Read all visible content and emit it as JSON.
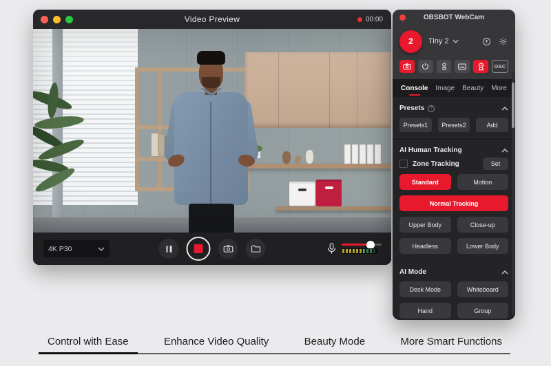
{
  "video_window": {
    "title": "Video Preview",
    "rec_time": "00:00",
    "resolution": "4K P30"
  },
  "panel": {
    "title": "OBSBOT WebCam",
    "device_badge": "2",
    "device_name": "Tiny 2",
    "toolbar": {
      "osc_label": "OSC"
    },
    "tabs": [
      "Console",
      "Image",
      "Beauty",
      "More"
    ],
    "active_tab": "Console",
    "presets": {
      "title": "Presets",
      "help_glyph": "?",
      "buttons": [
        "Presets1",
        "Presets2",
        "Add"
      ]
    },
    "tracking": {
      "title": "AI Human Tracking",
      "zone_label": "Zone Tracking",
      "zone_checked": false,
      "set_label": "Set",
      "standard": "Standard",
      "motion": "Motion",
      "normal": "Normal Tracking",
      "upper": "Upper Body",
      "closeup": "Close-up",
      "headless": "Headless",
      "lower": "Lower Body",
      "active_mode": "Standard",
      "active_tracking": "Normal Tracking"
    },
    "ai_mode": {
      "title": "AI Mode",
      "buttons": [
        "Desk Mode",
        "Whiteboard",
        "Hand",
        "Group"
      ]
    }
  },
  "bottom_tabs": [
    {
      "label": "Control with Ease",
      "active": true
    },
    {
      "label": "Enhance Video Quality",
      "active": false
    },
    {
      "label": "Beauty Mode",
      "active": false
    },
    {
      "label": "More Smart Functions",
      "active": false
    }
  ],
  "icons": {
    "gear": "⚙"
  },
  "colors": {
    "accent_red": "#e8192c",
    "panel_bg": "#242427",
    "header_bg": "#37373a",
    "traffic_red": "#ff5f57",
    "traffic_yellow": "#febc2e",
    "traffic_green": "#28c840",
    "box_red": "#c01f40",
    "meter_yellow": "#b2a22b",
    "meter_green": "#2f7d4f"
  }
}
